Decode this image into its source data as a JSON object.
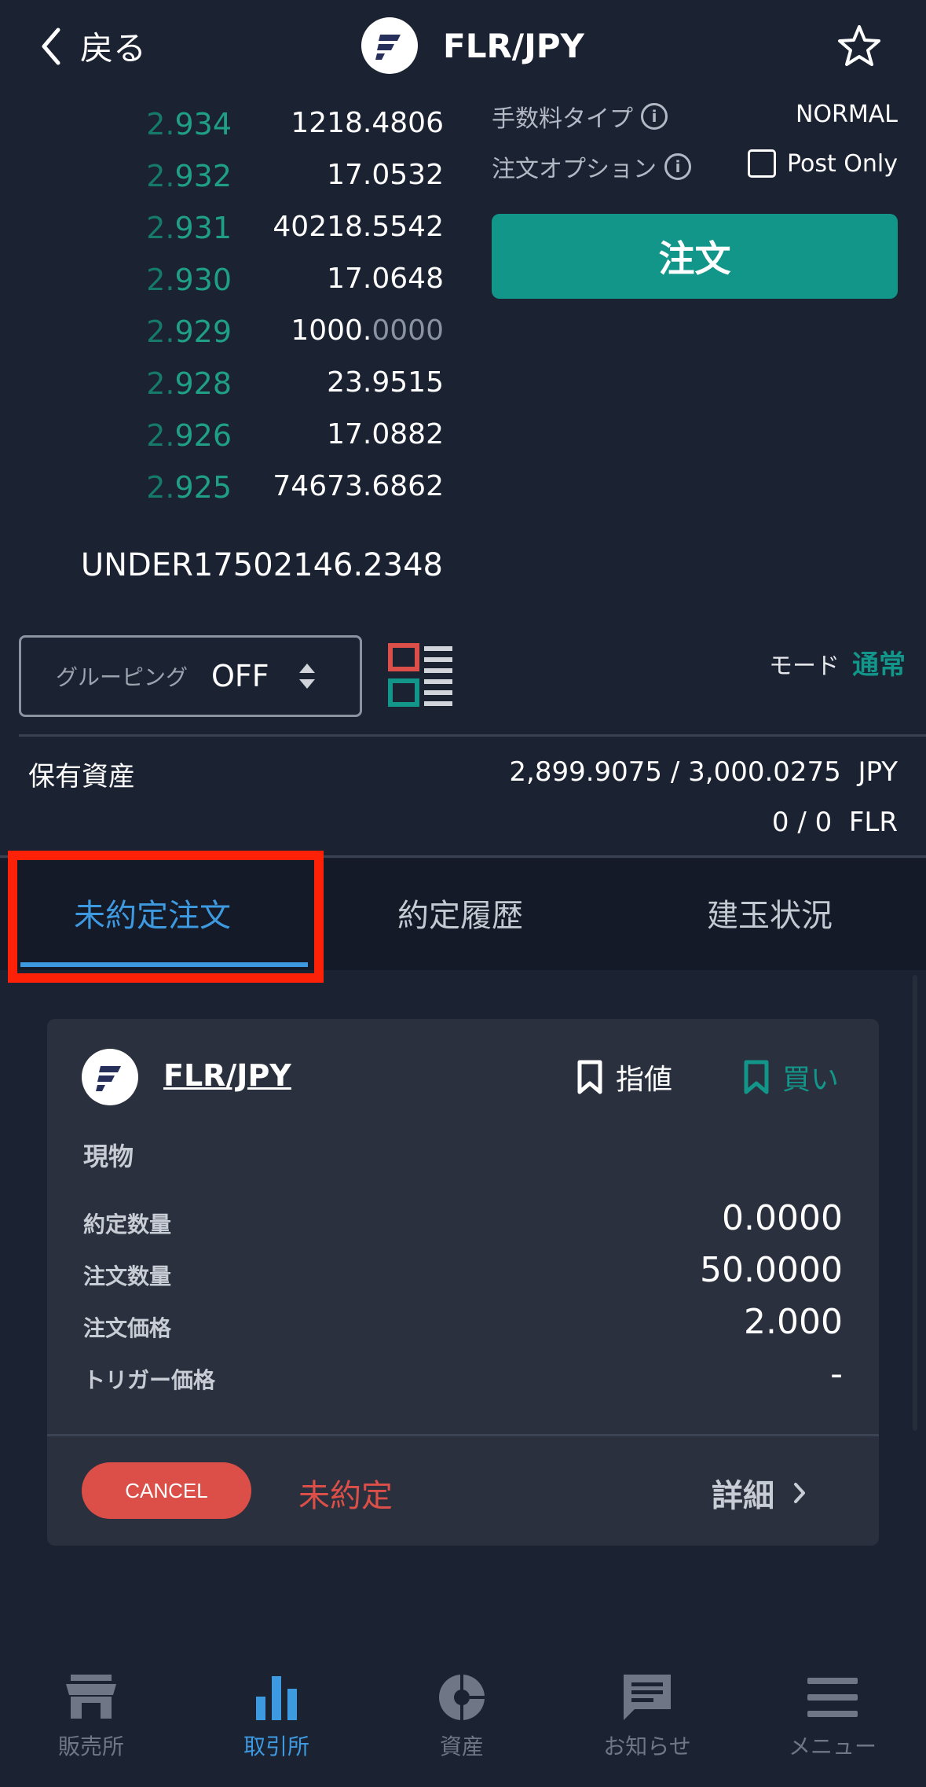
{
  "header": {
    "back_label": "戻る",
    "pair": "FLR/JPY"
  },
  "orderbook": {
    "rows": [
      {
        "lead": "2.",
        "tail": "934",
        "qty_main": "1218.4806",
        "qty_dim": ""
      },
      {
        "lead": "2.",
        "tail": "932",
        "qty_main": "17.0532",
        "qty_dim": ""
      },
      {
        "lead": "2.",
        "tail": "931",
        "qty_main": "40218.5542",
        "qty_dim": ""
      },
      {
        "lead": "2.",
        "tail": "930",
        "qty_main": "17.0648",
        "qty_dim": ""
      },
      {
        "lead": "2.",
        "tail": "929",
        "qty_main": "1000.",
        "qty_dim": "0000"
      },
      {
        "lead": "2.",
        "tail": "928",
        "qty_main": "23.9515",
        "qty_dim": ""
      },
      {
        "lead": "2.",
        "tail": "926",
        "qty_main": "17.0882",
        "qty_dim": ""
      },
      {
        "lead": "2.",
        "tail": "925",
        "qty_main": "74673.6862",
        "qty_dim": ""
      }
    ],
    "under": "UNDER17502146.2348"
  },
  "order_panel": {
    "fee_type_label": "手数料タイプ",
    "fee_type_value": "NORMAL",
    "option_label": "注文オプション",
    "post_only_label": "Post Only",
    "order_button": "注文"
  },
  "grouping": {
    "label": "グルーピング",
    "value": "OFF"
  },
  "mode": {
    "label": "モード",
    "value": "通常"
  },
  "assets": {
    "label": "保有資産",
    "jpy": "2,899.9075 / 3,000.0275",
    "jpy_unit": "JPY",
    "flr": "0 / 0",
    "flr_unit": "FLR"
  },
  "tabs": [
    {
      "label": "未約定注文"
    },
    {
      "label": "約定履歴"
    },
    {
      "label": "建玉状況"
    }
  ],
  "order_card": {
    "pair": "FLR/JPY",
    "order_type": "指値",
    "side": "買い",
    "product": "現物",
    "rows": [
      {
        "label": "約定数量",
        "value": "0.0000"
      },
      {
        "label": "注文数量",
        "value": "50.0000"
      },
      {
        "label": "注文価格",
        "value": "2.000"
      },
      {
        "label": "トリガー価格",
        "value": "-"
      }
    ],
    "cancel_label": "CANCEL",
    "status": "未約定",
    "detail_label": "詳細"
  },
  "colors": {
    "accent": "#13968a",
    "blue": "#3e9ae0",
    "red": "#dc4f48",
    "highlight": "#fd2107",
    "background": "#1b2232"
  },
  "bottom_nav": [
    {
      "label": "販売所",
      "icon": "store-icon"
    },
    {
      "label": "取引所",
      "icon": "bar-chart-icon"
    },
    {
      "label": "資産",
      "icon": "pie-chart-icon"
    },
    {
      "label": "お知らせ",
      "icon": "message-icon"
    },
    {
      "label": "メニュー",
      "icon": "menu-icon"
    }
  ]
}
